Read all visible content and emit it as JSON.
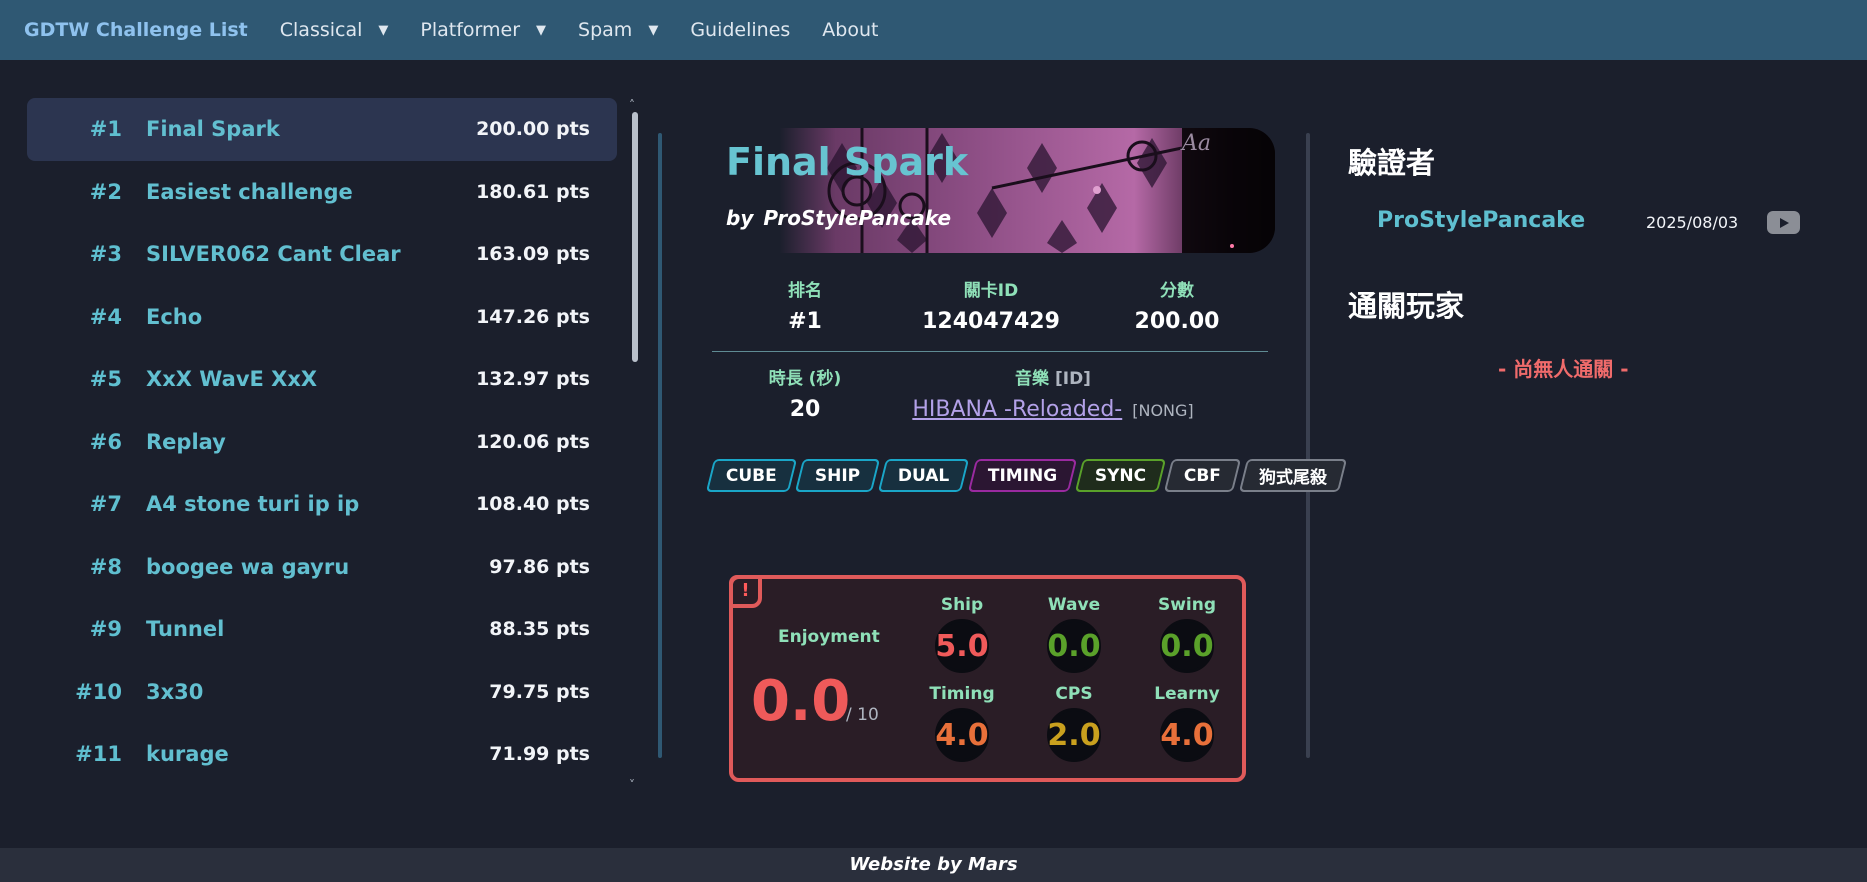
{
  "nav": {
    "brand": "GDTW Challenge List",
    "items": [
      {
        "label": "Classical",
        "dropdown": true
      },
      {
        "label": "Platformer",
        "dropdown": true
      },
      {
        "label": "Spam",
        "dropdown": true
      },
      {
        "label": "Guidelines",
        "dropdown": false
      },
      {
        "label": "About",
        "dropdown": false
      }
    ]
  },
  "list": [
    {
      "rank": "#1",
      "name": "Final Spark",
      "pts": "200.00 pts"
    },
    {
      "rank": "#2",
      "name": "Easiest challenge",
      "pts": "180.61 pts"
    },
    {
      "rank": "#3",
      "name": "SILVER062 Cant Clear",
      "pts": "163.09 pts"
    },
    {
      "rank": "#4",
      "name": "Echo",
      "pts": "147.26 pts"
    },
    {
      "rank": "#5",
      "name": "XxX WavE XxX",
      "pts": "132.97 pts"
    },
    {
      "rank": "#6",
      "name": "Replay",
      "pts": "120.06 pts"
    },
    {
      "rank": "#7",
      "name": "A4 stone turi ip ip",
      "pts": "108.40 pts"
    },
    {
      "rank": "#8",
      "name": "boogee wa gayru",
      "pts": "97.86 pts"
    },
    {
      "rank": "#9",
      "name": "Tunnel",
      "pts": "88.35 pts"
    },
    {
      "rank": "#10",
      "name": "3x30",
      "pts": "79.75 pts"
    },
    {
      "rank": "#11",
      "name": "kurage",
      "pts": "71.99 pts"
    }
  ],
  "level": {
    "title": "Final Spark",
    "by_label": "by",
    "creator": "ProStylePancake",
    "rank_label": "排名",
    "rank": "#1",
    "id_label": "關卡ID",
    "id": "124047429",
    "score_label": "分數",
    "score": "200.00",
    "length_label": "時長 (秒)",
    "length": "20",
    "music_label": "音樂",
    "music_id_label": "[ID]",
    "song": "HIBANA -Reloaded-",
    "nong": "[NONG]"
  },
  "tags": [
    {
      "label": "CUBE",
      "color": "#1aa6c8",
      "bg": "#17303f"
    },
    {
      "label": "SHIP",
      "color": "#1aa6c8",
      "bg": "#17303f"
    },
    {
      "label": "DUAL",
      "color": "#1aa6c8",
      "bg": "#17303f"
    },
    {
      "label": "TIMING",
      "color": "#9a2aa0",
      "bg": "#2b1632"
    },
    {
      "label": "SYNC",
      "color": "#5aa12a",
      "bg": "#1f2c1c"
    },
    {
      "label": "CBF",
      "color": "#7a7f8a",
      "bg": "#262a33"
    },
    {
      "label": "狗式尾殺",
      "color": "#7a7f8a",
      "bg": "#262a33"
    }
  ],
  "rating": {
    "warn": "!",
    "enjoyment_label": "Enjoyment",
    "enjoyment": "0.0",
    "enjoyment_max": "/ 10",
    "stats": [
      {
        "label": "Ship",
        "value": "5.0",
        "color": "#ef5a5a"
      },
      {
        "label": "Wave",
        "value": "0.0",
        "color": "#5aa12a"
      },
      {
        "label": "Swing",
        "value": "0.0",
        "color": "#5aa12a"
      },
      {
        "label": "Timing",
        "value": "4.0",
        "color": "#e8703a"
      },
      {
        "label": "CPS",
        "value": "2.0",
        "color": "#c9a01e"
      },
      {
        "label": "Learny",
        "value": "4.0",
        "color": "#e8703a"
      }
    ]
  },
  "right": {
    "verifier_heading": "驗證者",
    "verifier": "ProStylePancake",
    "verify_date": "2025/08/03",
    "players_heading": "通關玩家",
    "none": "- 尚無人通關 -"
  },
  "footer": "Website by Mars"
}
